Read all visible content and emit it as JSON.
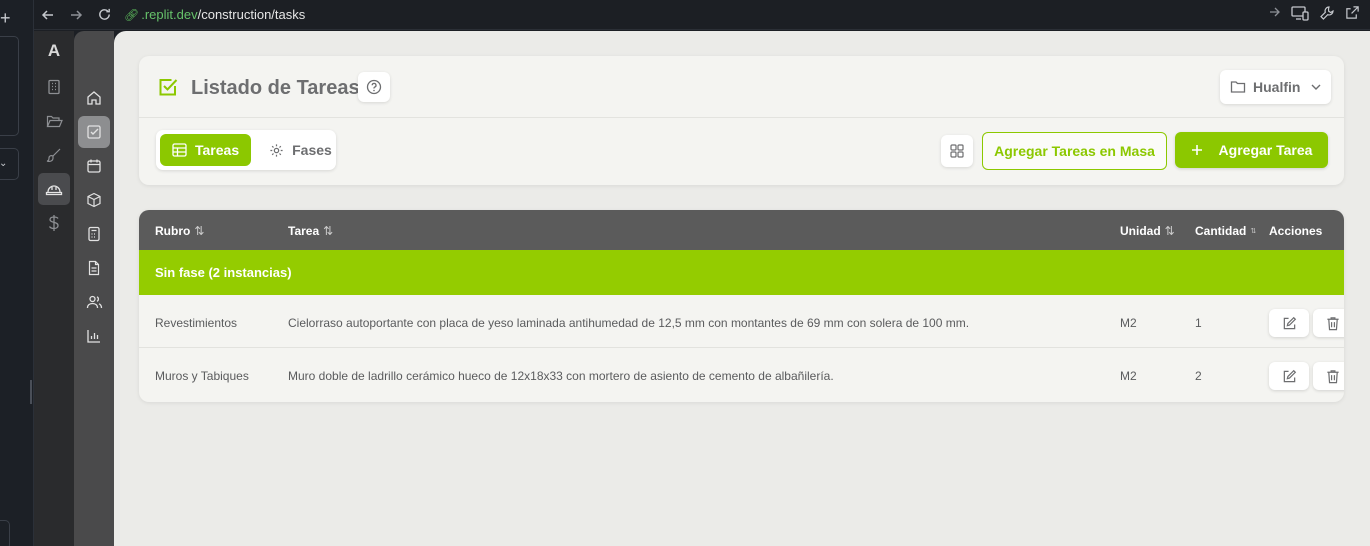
{
  "browser": {
    "url_host": ".replit.dev",
    "url_path": "/construction/tasks"
  },
  "app": {
    "logo": "A"
  },
  "header": {
    "title": "Listado de Tareas",
    "project": "Hualfin"
  },
  "tabs": [
    {
      "label": "Tareas",
      "active": true,
      "icon": "table-icon"
    },
    {
      "label": "Fases",
      "active": false,
      "icon": "gear-icon"
    }
  ],
  "actions": {
    "bulk_add": "Agregar Tareas en Masa",
    "add": "Agregar Tarea"
  },
  "table": {
    "columns": {
      "rubro": "Rubro",
      "tarea": "Tarea",
      "unidad": "Unidad",
      "cantidad": "Cantidad",
      "acciones": "Acciones"
    },
    "group_label": "Sin fase (2 instancias)",
    "rows": [
      {
        "rubro": "Revestimientos",
        "tarea": "Cielorraso autoportante con placa de yeso laminada antihumedad de 12,5 mm con montantes de 69 mm con solera de 100 mm.",
        "unidad": "M2",
        "cantidad": "1"
      },
      {
        "rubro": "Muros y Tabiques",
        "tarea": "Muro doble de ladrillo cerámico hueco de 12x18x33 con mortero de asiento de cemento de albañilería.",
        "unidad": "M2",
        "cantidad": "2"
      }
    ]
  },
  "colors": {
    "accent": "#8cc800",
    "group_bar": "#94cc00",
    "table_header": "#5b5b5b"
  }
}
